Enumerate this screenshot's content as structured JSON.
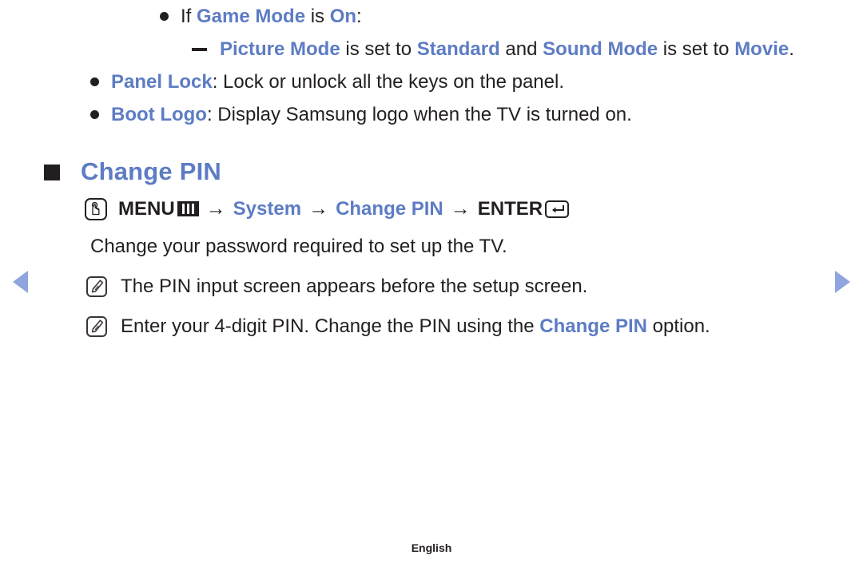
{
  "document": {
    "language_footer": "English",
    "accent_color": "#5d7cc4",
    "text_color": "#231f20",
    "arrow_color": "#8fa5dd"
  },
  "bullets": {
    "game_mode": {
      "lead": "If ",
      "term1": "Game Mode",
      "mid": " is ",
      "term2": "On",
      "tail": ":"
    },
    "sub_picture_mode": {
      "term1": "Picture Mode",
      "mid1": " is set to ",
      "term2": "Standard",
      "mid2": " and ",
      "term3": "Sound Mode",
      "mid3": " is set to ",
      "term4": "Movie",
      "tail": "."
    },
    "panel_lock": {
      "term": "Panel Lock",
      "rest": ": Lock or unlock all the keys on the panel."
    },
    "boot_logo": {
      "term": "Boot Logo",
      "rest": ": Display Samsung logo when the TV is turned on."
    }
  },
  "section": {
    "title": "Change PIN",
    "menu_path": {
      "hand_icon": "hand-press-icon",
      "menu_label": "MENU",
      "menu_icon": "menu-bars-icon",
      "arrow1": "→",
      "item1": "System",
      "arrow2": "→",
      "item2": "Change PIN",
      "arrow3": "→",
      "enter_label": "ENTER",
      "enter_icon": "enter-key-icon"
    },
    "description": "Change your password required to set up the TV.",
    "notes": [
      {
        "icon": "note-pencil-icon",
        "text": "The PIN input screen appears before the setup screen.",
        "highlight": "",
        "text_after": ""
      },
      {
        "icon": "note-pencil-icon",
        "text": "Enter your 4-digit PIN. Change the PIN using the ",
        "highlight": "Change PIN",
        "text_after": " option."
      }
    ]
  },
  "navigation": {
    "prev_label": "previous-page-arrow",
    "next_label": "next-page-arrow"
  }
}
